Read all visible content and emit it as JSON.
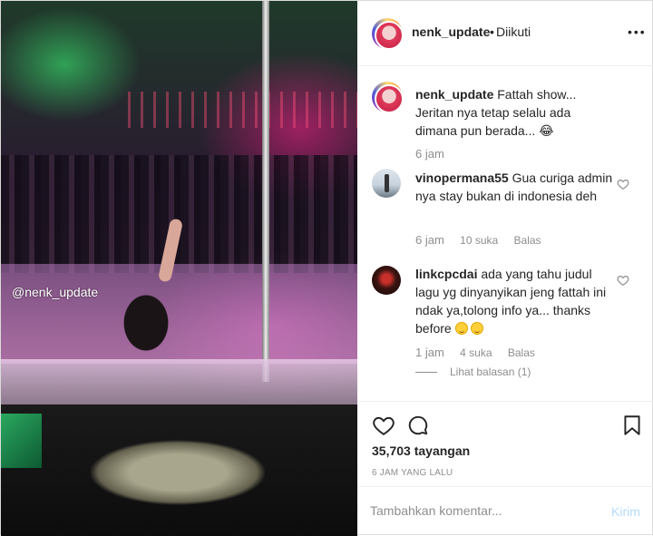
{
  "media": {
    "watermark": "@nenk_update"
  },
  "header": {
    "username": "nenk_update",
    "separator": "•",
    "follow_status": "Diikuti",
    "more": "•••"
  },
  "caption": {
    "username": "nenk_update",
    "text": "Fattah show... Jeritan nya tetap selalu ada dimana pun berada...",
    "emoji": "😂",
    "time": "6 jam"
  },
  "comments": [
    {
      "username": "vinopermana55",
      "text": "Gua curiga admin nya stay bukan di indonesia deh",
      "time": "6 jam",
      "likes": "10 suka",
      "reply": "Balas"
    },
    {
      "username": "linkcpcdai",
      "text": "ada yang tahu judul lagu yg dinyanyikan jeng fattah ini ndak ya,tolong info ya... thanks before",
      "time": "1 jam",
      "likes": "4 suka",
      "reply": "Balas",
      "replies_label": "Lihat balasan (1)"
    }
  ],
  "stats": {
    "views": "35,703 tayangan",
    "posted": "6 JAM YANG LALU"
  },
  "add_comment": {
    "placeholder": "Tambahkan komentar...",
    "post_label": "Kirim"
  },
  "icons": {
    "like": "heart-icon",
    "comment": "comment-icon",
    "save": "bookmark-icon",
    "more": "more-icon"
  },
  "colors": {
    "link": "#b3dbff",
    "muted": "#8e8e8e",
    "text": "#262626",
    "border": "#dbdbdb"
  }
}
